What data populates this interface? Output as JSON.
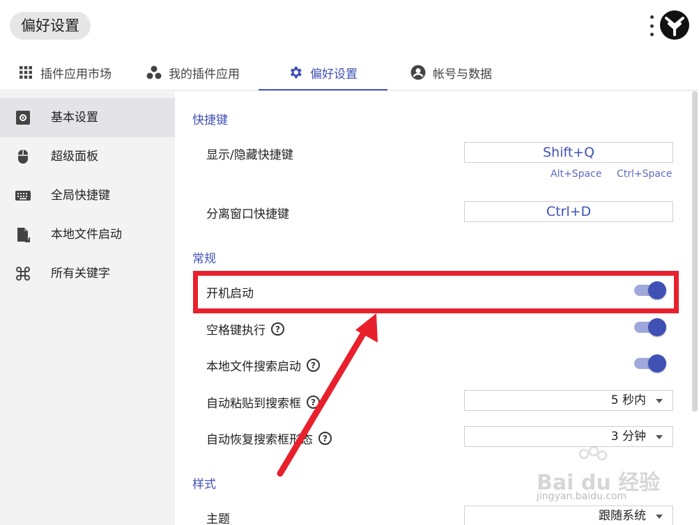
{
  "header": {
    "title": "偏好设置"
  },
  "tabs": [
    {
      "label": "插件应用市场",
      "icon": "apps-grid-icon"
    },
    {
      "label": "我的插件应用",
      "icon": "bubbles-icon"
    },
    {
      "label": "偏好设置",
      "icon": "gear-icon",
      "active": true
    },
    {
      "label": "帐号与数据",
      "icon": "account-circle-icon"
    }
  ],
  "sidebar": {
    "items": [
      {
        "label": "基本设置",
        "icon": "settings-box-icon",
        "active": true
      },
      {
        "label": "超级面板",
        "icon": "mouse-icon"
      },
      {
        "label": "全局快捷键",
        "icon": "keyboard-icon"
      },
      {
        "label": "本地文件启动",
        "icon": "file-launch-icon"
      },
      {
        "label": "所有关键字",
        "icon": "command-icon"
      }
    ]
  },
  "sections": {
    "shortcuts": {
      "title": "快捷键",
      "show_hide_label": "显示/隐藏快捷键",
      "show_hide_value": "Shift+Q",
      "hint_alt": "Alt+Space",
      "hint_ctrl": "Ctrl+Space",
      "detach_label": "分离窗口快捷键",
      "detach_value": "Ctrl+D"
    },
    "general": {
      "title": "常规",
      "autostart_label": "开机启动",
      "autostart_on": true,
      "space_exec_label": "空格键执行",
      "space_exec_on": true,
      "local_search_label": "本地文件搜索启动",
      "local_search_on": true,
      "auto_paste_label": "自动粘贴到搜索框",
      "auto_paste_value": "5 秒内",
      "auto_restore_label": "自动恢复搜索框形态",
      "auto_restore_value": "3 分钟"
    },
    "style": {
      "title": "样式",
      "theme_label": "主题",
      "theme_value": "跟随系统"
    }
  },
  "watermark": {
    "brand": "Bai du 经验",
    "url": "jingyan.baidu.com"
  },
  "colors": {
    "accent": "#3f51b5",
    "toggle_track": "#9fa8da",
    "annotation_red": "#e8202c"
  }
}
